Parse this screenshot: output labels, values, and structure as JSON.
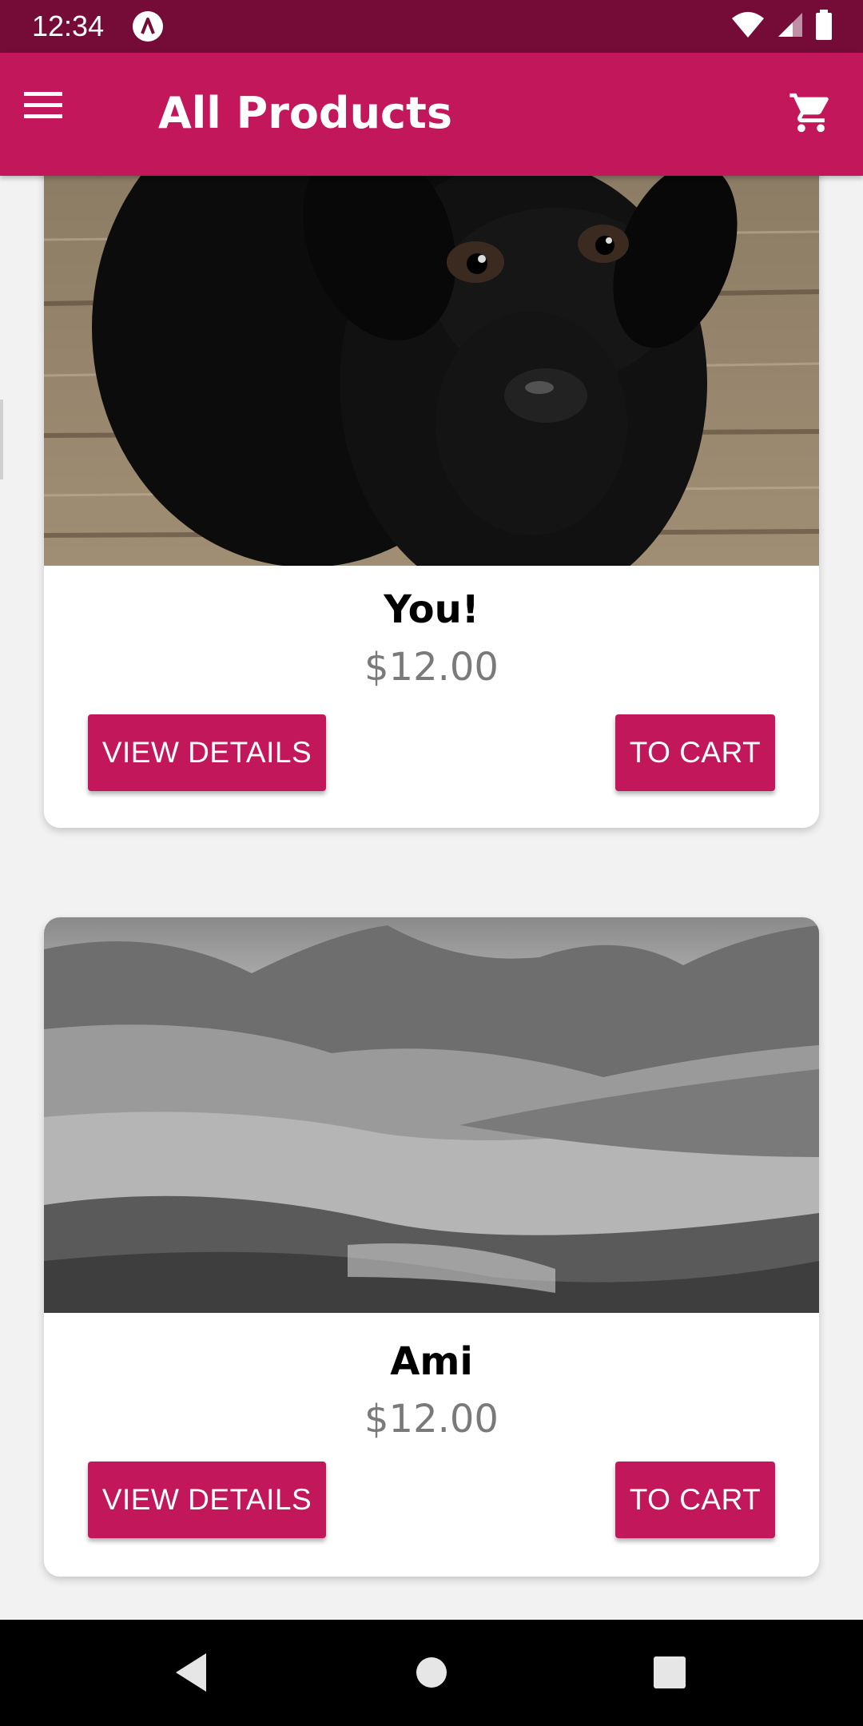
{
  "status_bar": {
    "time": "12:34",
    "icons": [
      "app-notification-icon",
      "wifi-icon",
      "cellular-signal-icon",
      "battery-icon"
    ]
  },
  "app_bar": {
    "title": "All Products",
    "menu_icon": "menu-icon",
    "cart_icon": "shopping-cart-icon"
  },
  "products": [
    {
      "name": "You!",
      "price": "$12.00",
      "image": "black-puppy-photo",
      "view_details_label": "VIEW DETAILS",
      "to_cart_label": "TO CART"
    },
    {
      "name": "Ami",
      "price": "$12.00",
      "image": "mountain-landscape-photo",
      "view_details_label": "VIEW DETAILS",
      "to_cart_label": "TO CART"
    }
  ],
  "nav_bar": {
    "icons": [
      "back-icon",
      "home-icon",
      "recents-icon"
    ]
  },
  "colors": {
    "primary": "#c2185b",
    "primary_dark": "#740c37",
    "background": "#f2f2f2",
    "price_text": "#7a7a7a"
  }
}
